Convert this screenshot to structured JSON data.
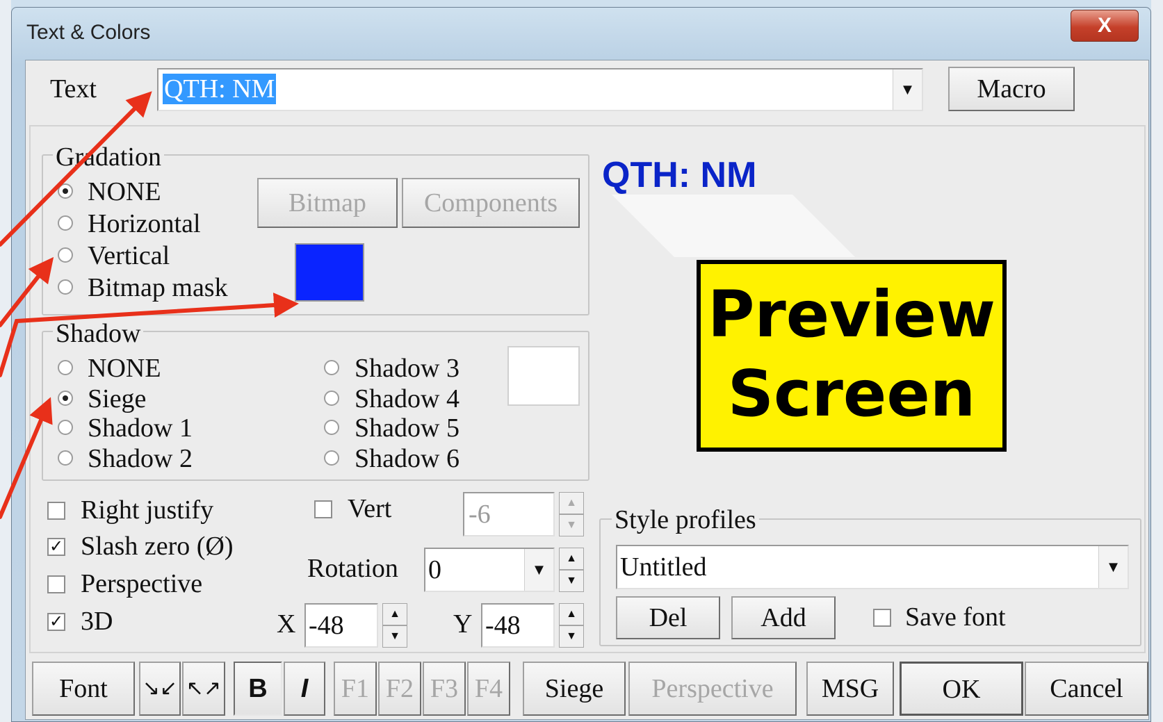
{
  "window": {
    "title": "Text & Colors",
    "close_label": "X"
  },
  "text_row": {
    "label": "Text",
    "value": "QTH: NM",
    "macro_label": "Macro"
  },
  "gradation": {
    "legend": "Gradation",
    "options": [
      "NONE",
      "Horizontal",
      "Vertical",
      "Bitmap mask"
    ],
    "selected": "NONE",
    "bitmap_label": "Bitmap",
    "components_label": "Components",
    "color": "#0a24ff"
  },
  "shadow": {
    "legend": "Shadow",
    "left_options": [
      "NONE",
      "Siege",
      "Shadow 1",
      "Shadow 2"
    ],
    "right_options": [
      "Shadow 3",
      "Shadow 4",
      "Shadow 5",
      "Shadow 6"
    ],
    "selected": "Siege",
    "color": "#ffffff"
  },
  "options": {
    "right_justify": {
      "label": "Right justify",
      "checked": false
    },
    "slash_zero": {
      "label": "Slash zero (Ø)",
      "checked": true
    },
    "perspective": {
      "label": "Perspective",
      "checked": false
    },
    "three_d": {
      "label": "3D",
      "checked": true
    },
    "vert": {
      "label": "Vert",
      "checked": false
    },
    "vert_value": "-6",
    "rotation_label": "Rotation",
    "rotation_value": "0",
    "x_label": "X",
    "x_value": "-48",
    "y_label": "Y",
    "y_value": "-48"
  },
  "preview": {
    "text": "QTH: NM",
    "color": "#0a24c8"
  },
  "callout": {
    "line1": "Preview",
    "line2": "Screen",
    "bg": "#fff200"
  },
  "style_profiles": {
    "legend": "Style profiles",
    "value": "Untitled",
    "del_label": "Del",
    "add_label": "Add",
    "save_font": {
      "label": "Save font",
      "checked": false
    }
  },
  "toolbar": {
    "font_label": "Font",
    "bold_label": "B",
    "italic_label": "I",
    "f1": "F1",
    "f2": "F2",
    "f3": "F3",
    "f4": "F4",
    "siege_label": "Siege",
    "perspective_label": "Perspective",
    "msg_label": "MSG",
    "ok_label": "OK",
    "cancel_label": "Cancel"
  },
  "annotation_color": "#e8301a"
}
